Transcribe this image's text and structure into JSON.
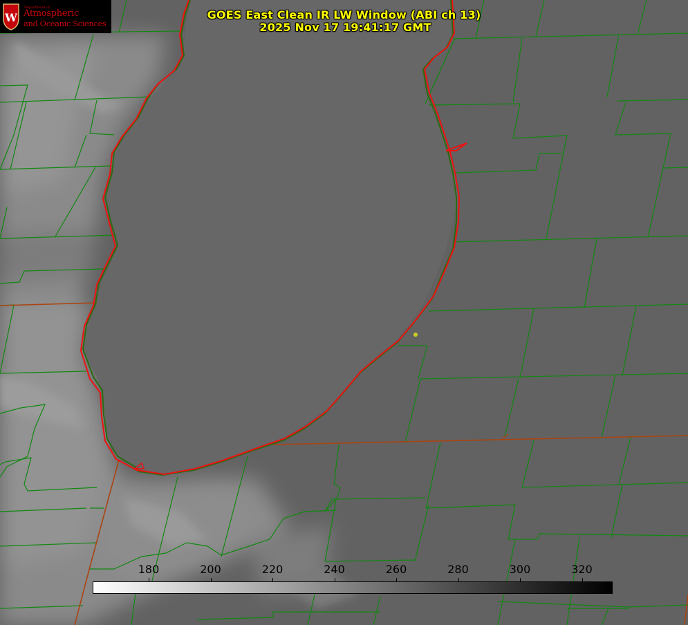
{
  "header": {
    "title_line1": "GOES East Clean IR LW Window (ABI ch 13)",
    "title_line2": "2025 Nov 17 19:41:17 GMT"
  },
  "logo": {
    "dept_small": "Department of",
    "line1": "Atmospheric",
    "line2": "and Oceanic Sciences",
    "seal_letter": "W",
    "seal_color": "#c5050c"
  },
  "colorbar": {
    "tick_labels": [
      "180",
      "200",
      "220",
      "240",
      "260",
      "280",
      "300",
      "320"
    ],
    "start_color": "#ffffff",
    "end_color": "#000000"
  },
  "colors": {
    "county_lines": "#118811",
    "state_lines": "#aa4411",
    "lake_shoreline": "#ee1111",
    "station_marker": "#cccc22",
    "title_text": "#ffff00"
  }
}
